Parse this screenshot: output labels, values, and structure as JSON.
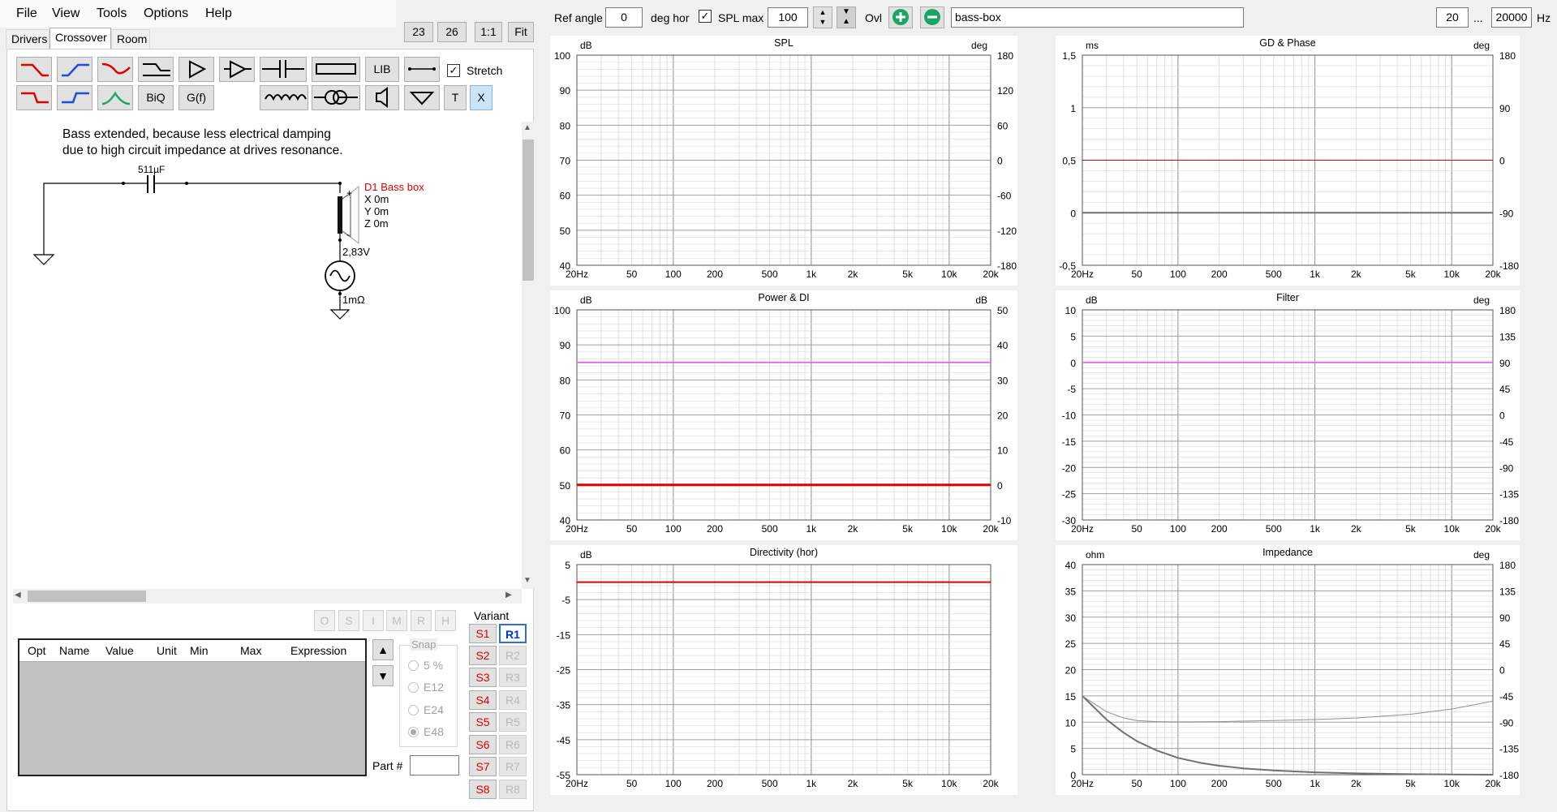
{
  "menu": {
    "file": "File",
    "view": "View",
    "tools": "Tools",
    "options": "Options",
    "help": "Help"
  },
  "tabs": {
    "drivers": "Drivers",
    "crossover": "Crossover",
    "room": "Room"
  },
  "zoom": {
    "z23": "23",
    "z26": "26",
    "one_to_one": "1:1",
    "fit": "Fit"
  },
  "toolbar": {
    "lib": "LIB",
    "biq": "BiQ",
    "gf": "G(f)",
    "t": "T",
    "x": "X",
    "stretch_label": "Stretch",
    "stretch_checked": true
  },
  "schematic": {
    "note_line1": "Bass extended, because less electrical damping",
    "note_line2": "due to high circuit impedance at drives resonance.",
    "capacitor": "511µF",
    "driver_name": "D1 Bass box",
    "driver_x": "X 0m",
    "driver_y": "Y 0m",
    "driver_z": "Z 0m",
    "source_voltage": "2,83V",
    "source_resistance": "1mΩ",
    "plus": "+",
    "minus": "-"
  },
  "optbuttons": [
    "O",
    "S",
    "I",
    "M",
    "R",
    "H"
  ],
  "parts_table": {
    "headers": [
      "Opt",
      "Name",
      "Value",
      "Unit",
      "Min",
      "Max",
      "Expression"
    ]
  },
  "snap": {
    "title": "Snap",
    "options": [
      "5 %",
      "E12",
      "E24",
      "E48"
    ],
    "selected": "E48"
  },
  "part_no_label": "Part #",
  "variant": {
    "title": "Variant",
    "s": [
      "S1",
      "S2",
      "S3",
      "S4",
      "S5",
      "S6",
      "S7",
      "S8"
    ],
    "r": [
      "R1",
      "R2",
      "R3",
      "R4",
      "R5",
      "R6",
      "R7",
      "R8"
    ],
    "selected_r": "R1"
  },
  "topbar": {
    "ref_angle_label": "Ref angle",
    "ref_angle_value": "0",
    "deg_hor": "deg hor",
    "spl_max_label": "SPL max",
    "spl_max_checked": true,
    "spl_max_value": "100",
    "ovl": "Ovl",
    "name_value": "bass-box",
    "fmin": "20",
    "ellipsis": "...",
    "fmax": "20000",
    "hz": "Hz"
  },
  "colors": {
    "red": "#e00000",
    "magenta": "#e070e0",
    "gray": "#707070",
    "grid": "#d8d8d8",
    "gridmajor": "#a0a0a0",
    "green": "#1aa568"
  },
  "x_ticks": [
    "20Hz",
    "50",
    "100",
    "200",
    "500",
    "1k",
    "2k",
    "5k",
    "10k",
    "20k"
  ],
  "chart_data": [
    {
      "id": "spl",
      "type": "line",
      "title": "SPL",
      "left_unit": "dB",
      "right_unit": "deg",
      "left_ticks": [
        "100",
        "90",
        "80",
        "70",
        "60",
        "50",
        "40"
      ],
      "right_ticks": [
        "180",
        "120",
        "60",
        "0",
        "-60",
        "-120",
        "-180"
      ],
      "x_scale": "log",
      "xlim": [
        20,
        20000
      ],
      "ylim": [
        40,
        100
      ],
      "series": []
    },
    {
      "id": "gd-phase",
      "type": "line",
      "title": "GD & Phase",
      "left_unit": "ms",
      "right_unit": "deg",
      "left_ticks": [
        "1,5",
        "1",
        "0,5",
        "0",
        "-0,5"
      ],
      "right_ticks": [
        "180",
        "90",
        "0",
        "-90",
        "-180"
      ],
      "x_scale": "log",
      "xlim": [
        20,
        20000
      ],
      "ylim": [
        -0.5,
        1.5
      ],
      "series": [
        {
          "color": "#e00000",
          "width": 1,
          "x": [
            20,
            20000
          ],
          "y": [
            0.5,
            0.5
          ]
        },
        {
          "color": "#707070",
          "width": 2,
          "x": [
            20,
            20000
          ],
          "y": [
            0,
            0
          ]
        }
      ]
    },
    {
      "id": "power-di",
      "type": "line",
      "title": "Power & DI",
      "left_unit": "dB",
      "right_unit": "dB",
      "left_ticks": [
        "100",
        "90",
        "80",
        "70",
        "60",
        "50",
        "40"
      ],
      "right_ticks": [
        "50",
        "40",
        "30",
        "20",
        "10",
        "0",
        "-10"
      ],
      "x_scale": "log",
      "xlim": [
        20,
        20000
      ],
      "ylim": [
        40,
        100
      ],
      "series": [
        {
          "color": "#e070e0",
          "width": 2,
          "x": [
            20,
            20000
          ],
          "y": [
            85,
            85
          ]
        },
        {
          "color": "#e00000",
          "width": 3,
          "x": [
            20,
            20000
          ],
          "y": [
            50,
            50
          ]
        }
      ]
    },
    {
      "id": "filter",
      "type": "line",
      "title": "Filter",
      "left_unit": "dB",
      "right_unit": "deg",
      "left_ticks": [
        "10",
        "5",
        "0",
        "-5",
        "-10",
        "-15",
        "-20",
        "-25",
        "-30"
      ],
      "right_ticks": [
        "180",
        "135",
        "90",
        "45",
        "0",
        "-45",
        "-90",
        "-135",
        "-180"
      ],
      "x_scale": "log",
      "xlim": [
        20,
        20000
      ],
      "ylim": [
        -30,
        10
      ],
      "series": [
        {
          "color": "#e070e0",
          "width": 2,
          "x": [
            20,
            20000
          ],
          "y": [
            0,
            0
          ]
        }
      ]
    },
    {
      "id": "directivity",
      "type": "line",
      "title": "Directivity (hor)",
      "left_unit": "dB",
      "right_unit": "",
      "left_ticks": [
        "5",
        "-5",
        "-15",
        "-25",
        "-35",
        "-45",
        "-55"
      ],
      "right_ticks": [],
      "x_scale": "log",
      "xlim": [
        20,
        20000
      ],
      "ylim": [
        -55,
        5
      ],
      "series": [
        {
          "color": "#e00000",
          "width": 2,
          "x": [
            20,
            20000
          ],
          "y": [
            0,
            0
          ]
        }
      ]
    },
    {
      "id": "impedance",
      "type": "line",
      "title": "Impedance",
      "left_unit": "ohm",
      "right_unit": "deg",
      "left_ticks": [
        "40",
        "35",
        "30",
        "25",
        "20",
        "15",
        "10",
        "5",
        "0"
      ],
      "right_ticks": [
        "180",
        "135",
        "90",
        "45",
        "0",
        "-45",
        "-90",
        "-135",
        "-180"
      ],
      "x_scale": "log",
      "xlim": [
        20,
        20000
      ],
      "ylim": [
        0,
        40
      ],
      "series": [
        {
          "color": "#707070",
          "width": 2,
          "x": [
            20,
            30,
            40,
            50,
            70,
            100,
            150,
            200,
            300,
            500,
            1000,
            2000,
            5000,
            10000,
            20000
          ],
          "y": [
            15,
            10.5,
            8,
            6.4,
            4.6,
            3.2,
            2.2,
            1.7,
            1.2,
            0.8,
            0.45,
            0.25,
            0.1,
            0.05,
            0
          ]
        },
        {
          "color": "#909090",
          "width": 1,
          "x": [
            20,
            30,
            40,
            50,
            70,
            100,
            200,
            500,
            1000,
            2000,
            5000,
            10000,
            20000
          ],
          "y": [
            15,
            12,
            10.8,
            10.3,
            10.1,
            10.05,
            10.1,
            10.3,
            10.5,
            10.8,
            11.5,
            12.5,
            14
          ]
        }
      ]
    }
  ]
}
